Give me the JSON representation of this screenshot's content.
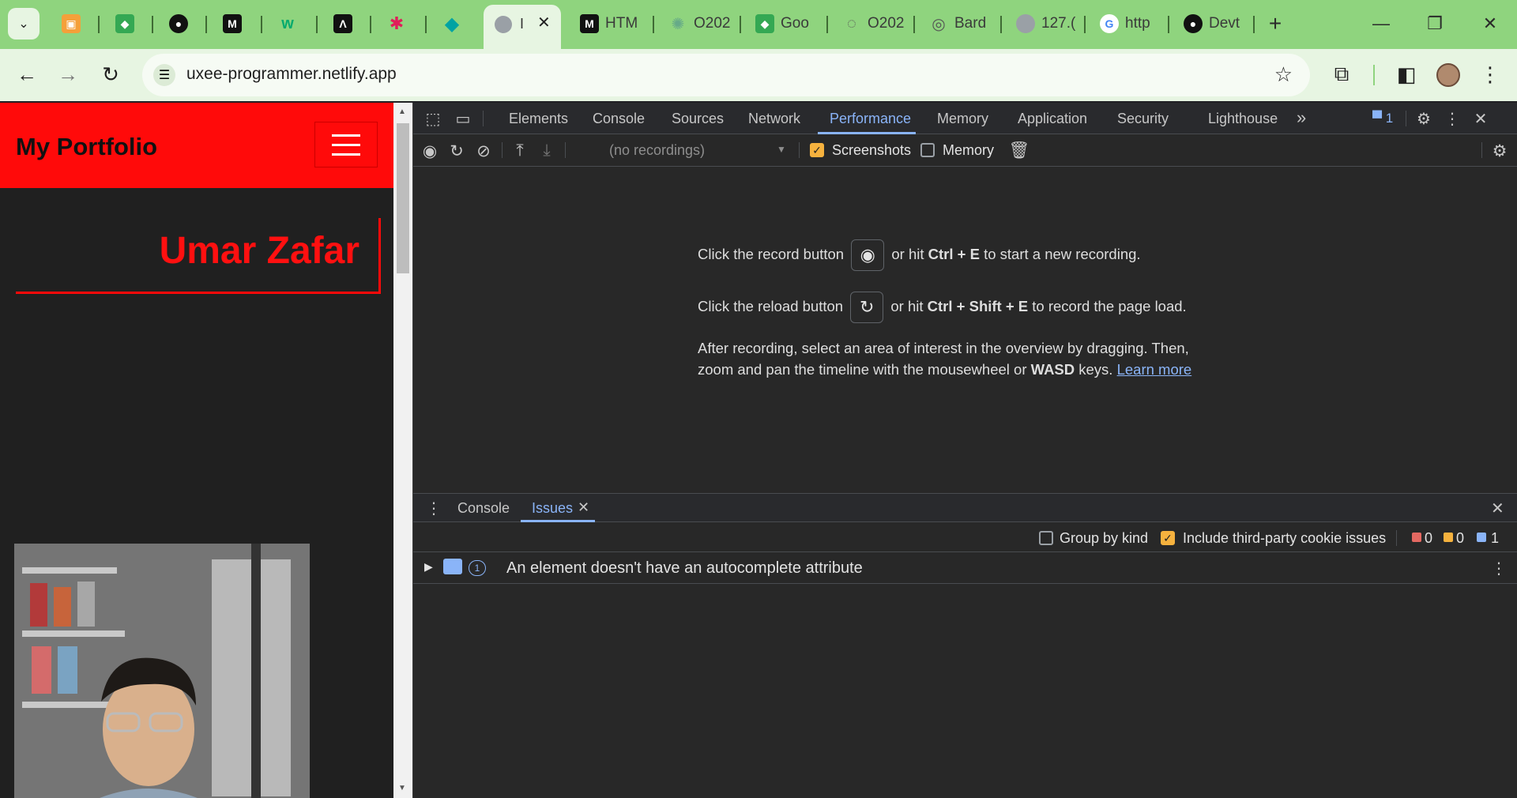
{
  "browser": {
    "tabs": [
      {
        "label": "",
        "icon": "slides-icon"
      },
      {
        "label": "",
        "icon": "maps-icon"
      },
      {
        "label": "",
        "icon": "github-icon"
      },
      {
        "label": "",
        "icon": "medium-icon"
      },
      {
        "label": "",
        "icon": "w3schools-icon"
      },
      {
        "label": "",
        "icon": "code-icon"
      },
      {
        "label": "",
        "icon": "slack-icon"
      },
      {
        "label": "",
        "icon": "diamond-icon"
      },
      {
        "label": "I",
        "icon": "globe-icon",
        "active": true
      },
      {
        "label": "HTM",
        "icon": "medium-icon"
      },
      {
        "label": "O202",
        "icon": "pinwheel-icon"
      },
      {
        "label": "Goo",
        "icon": "maps-icon"
      },
      {
        "label": "O202",
        "icon": "loading-icon"
      },
      {
        "label": "Bard",
        "icon": "bard-icon"
      },
      {
        "label": "127.(",
        "icon": "globe-icon"
      },
      {
        "label": "http",
        "icon": "google-icon"
      },
      {
        "label": "Devt",
        "icon": "github-icon"
      }
    ],
    "new_tab": "+",
    "url": "uxee-programmer.netlify.app"
  },
  "website": {
    "site_title": "My Portfolio",
    "person_name": "Umar Zafar"
  },
  "devtools": {
    "tabs": [
      "Elements",
      "Console",
      "Sources",
      "Network",
      "Performance",
      "Memory",
      "Application",
      "Security",
      "Lighthouse"
    ],
    "more_tabs": "»",
    "issues_count": "1",
    "recordings_placeholder": "(no recordings)",
    "screenshots_label": "Screenshots",
    "memory_label": "Memory",
    "landing": {
      "line1_pre": "Click the record button",
      "line1_post_a": "or hit ",
      "line1_kbd": "Ctrl + E",
      "line1_post_b": " to start a new recording.",
      "line2_pre": "Click the reload button",
      "line2_post_a": "or hit ",
      "line2_kbd": "Ctrl + Shift + E",
      "line2_post_b": " to record the page load.",
      "line3": "After recording, select an area of interest in the overview by dragging. Then,",
      "line4_pre": "zoom and pan the timeline with the mousewheel or ",
      "line4_kbd": "WASD",
      "line4_post": " keys. ",
      "learn_more": "Learn more"
    },
    "drawer": {
      "tabs": [
        "Console",
        "Issues"
      ],
      "group_by_kind": "Group by kind",
      "include_third_party": "Include third-party cookie issues",
      "errors": "0",
      "warnings": "0",
      "infos": "1",
      "issue_count": "1",
      "issue_text": "An element doesn't have an autocomplete attribute"
    }
  }
}
